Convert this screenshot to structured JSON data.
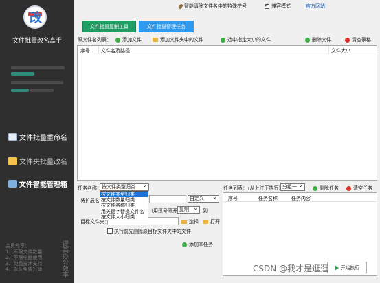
{
  "sidebar": {
    "app_name": "文件批量改名高手",
    "logo_glyph": "改",
    "menu": [
      {
        "label": "文件批量重命名",
        "icon": "document-icon"
      },
      {
        "label": "文件夹批量改名",
        "icon": "folder-icon"
      },
      {
        "label": "文件智能管理箱",
        "icon": "toolbox-icon"
      }
    ],
    "notes": [
      "会员专享：",
      "1、不限文件数量",
      "2、不限电脑使用",
      "3、免费技术支持",
      "4、永久免费升级"
    ],
    "side_vertical": "提高办公效率"
  },
  "topbar": {
    "clean_link": "智能清除文件名中的特殊符号",
    "compat_label": "兼容模式",
    "official_link": "官方网站"
  },
  "tabs": {
    "copy_tool": "文件批量复制工具",
    "manage_task": "文件批量管理任务"
  },
  "filelist": {
    "label": "原文件名列表：",
    "add_file": "添加文件",
    "add_folder_files": "添加文件夹中的文件",
    "select_by_size": "选中指定大小的文件",
    "delete_file": "删除文件",
    "clear_table": "清空表格",
    "columns": [
      "序号",
      "文件名及路径",
      "文件大小"
    ]
  },
  "task": {
    "name_label": "任务名称：",
    "name_value": "按文件类型归类",
    "options": [
      "按文件类型归类",
      "按文件数量归类",
      "按文件名称归类",
      "用关键字替换文件名",
      "按文件大小归类"
    ],
    "ext_label": "将扩展名",
    "custom_value": "自定义",
    "sep_hint": "（用逗号隔开）",
    "copy_value": "复制",
    "to_label": "到",
    "target_label": "目标文件夹：",
    "choose_label": "选择",
    "open_label": "打开",
    "delete_existing_label": "执行前先删除原目标文件夹中的文件",
    "add_task": "添加本任务"
  },
  "tasklist": {
    "label": "任务列表：（从上往下执行）",
    "group_value": "分组一",
    "delete_task": "删除任务",
    "clear_task": "清空任务",
    "columns": [
      "序号",
      "任务名称",
      "任务内容"
    ]
  },
  "watermark": "CSDN @我才是逛逛",
  "start_button": "开始执行"
}
